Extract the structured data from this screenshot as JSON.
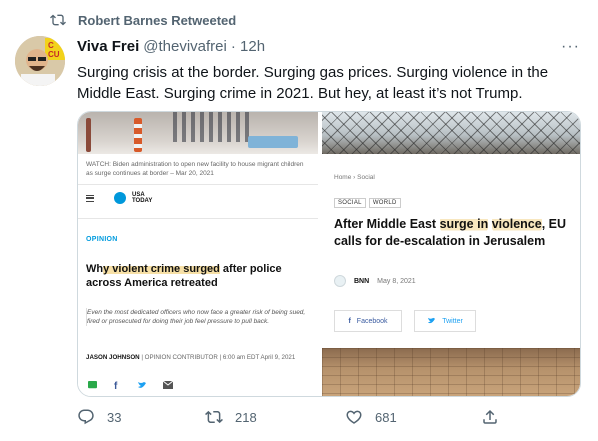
{
  "retweet_label": "Robert Barnes Retweeted",
  "author": {
    "name": "Viva Frei",
    "handle": "@thevivafrei",
    "time": "· 12h"
  },
  "more_label": "···",
  "tweet_text": "Surging crisis at the border. Surging gas prices. Surging violence in the Middle East. Surging crime in 2021. But hey, at least it’s not Trump.",
  "left_article": {
    "caption": "WATCH: Biden administration to open new facility to house migrant children as surge continues at border – Mar 20, 2021",
    "logo_line1": "USA",
    "logo_line2": "TODAY",
    "section": "OPINION",
    "headline_pre": "Wh",
    "headline_hl": "y violent crime surged",
    "headline_post": " after police across America retreated",
    "dek": "Even the most dedicated officers who now face a greater risk of being sued, fired or prosecuted for doing their job feel pressure to pull back.",
    "byline_name": "JASON JOHNSON",
    "byline_rest": " | OPINION CONTRIBUTOR | 6:00 am EDT April 9, 2021"
  },
  "right_article": {
    "breadcrumb": "Home › Social",
    "tags": [
      "SOCIAL",
      "WORLD"
    ],
    "headline_pre": "After Middle East ",
    "headline_hl1": "surge in",
    "headline_hl2": "violence",
    "headline_post": ", EU calls for de-escalation in Jerusalem",
    "source": "BNN",
    "date": "May 8, 2021",
    "facebook_label": "Facebook",
    "twitter_label": "Twitter"
  },
  "actions": {
    "replies": "33",
    "retweets": "218",
    "likes": "681"
  },
  "colors": {
    "muted": "#536471",
    "usatoday_blue": "#0098db",
    "highlight": "#f7e0a6"
  }
}
